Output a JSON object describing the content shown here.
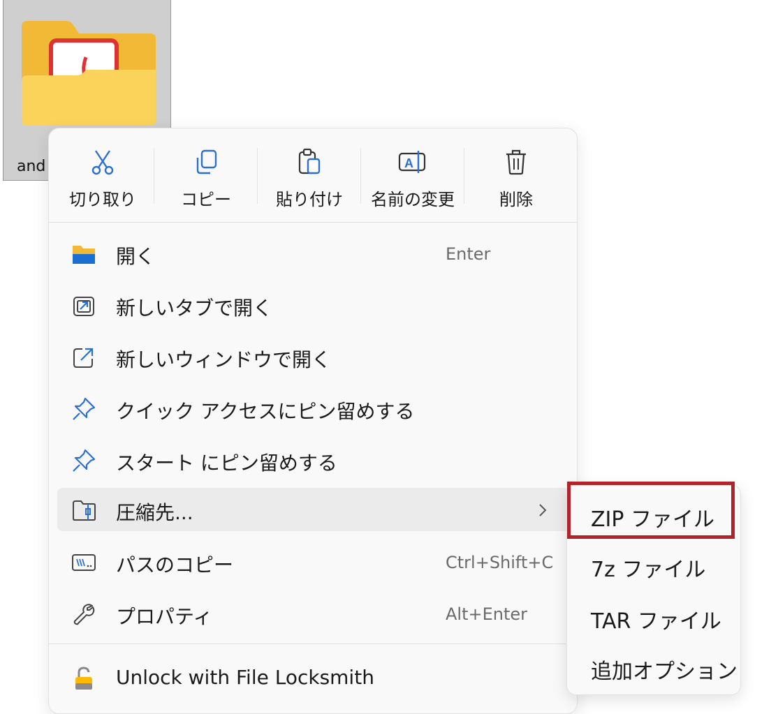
{
  "folder": {
    "label": "and"
  },
  "toolbar": {
    "cut": "切り取り",
    "copy": "コピー",
    "paste": "貼り付け",
    "rename": "名前の変更",
    "delete": "削除"
  },
  "menu_items": [
    {
      "label": "開く",
      "shortcut": "Enter",
      "icon": "folder-icon"
    },
    {
      "label": "新しいタブで開く",
      "shortcut": "",
      "icon": "new-tab-icon"
    },
    {
      "label": "新しいウィンドウで開く",
      "shortcut": "",
      "icon": "new-window-icon"
    },
    {
      "label": "クイック アクセスにピン留めする",
      "shortcut": "",
      "icon": "pin-icon"
    },
    {
      "label": "スタート にピン留めする",
      "shortcut": "",
      "icon": "pin-icon"
    },
    {
      "label": "圧縮先...",
      "shortcut": "",
      "icon": "zip-folder-icon",
      "has_submenu": true
    },
    {
      "label": "パスのコピー",
      "shortcut": "Ctrl+Shift+C",
      "icon": "copy-path-icon"
    },
    {
      "label": "プロパティ",
      "shortcut": "Alt+Enter",
      "icon": "wrench-icon"
    },
    {
      "label": "Unlock with File Locksmith",
      "shortcut": "",
      "icon": "lock-icon"
    }
  ],
  "submenu": {
    "items": [
      "ZIP ファイル",
      "7z ファイル",
      "TAR ファイル",
      "追加オプション"
    ]
  },
  "colors": {
    "highlight_box": "#b0232a",
    "accent_blue": "#1a6fd1"
  }
}
